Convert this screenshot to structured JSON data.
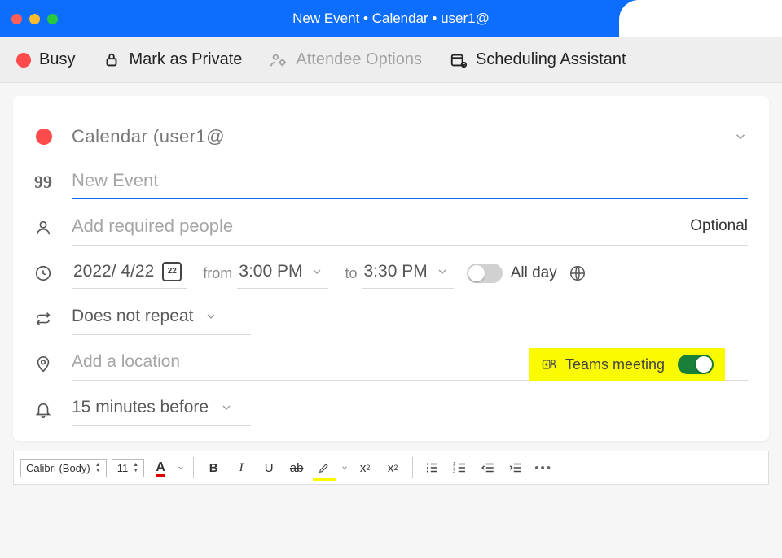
{
  "window": {
    "title": "New Event • Calendar • user1@"
  },
  "toolbar": {
    "busy_label": "Busy",
    "private_label": "Mark as Private",
    "attendee_label": "Attendee Options",
    "scheduling_label": "Scheduling Assistant"
  },
  "event": {
    "calendar_label": "Calendar (user1@",
    "title_placeholder": "New Event",
    "title_value": "",
    "people_placeholder": "Add required people",
    "optional_label": "Optional",
    "date": "2022/ 4/22",
    "date_mini": "22",
    "from_label": "from",
    "start_time": "3:00 PM",
    "to_label": "to",
    "end_time": "3:30 PM",
    "all_day_label": "All day",
    "all_day_on": false,
    "repeat_label": "Does not repeat",
    "location_placeholder": "Add a location",
    "teams_label": "Teams meeting",
    "teams_on": true,
    "reminder_label": "15 minutes before"
  },
  "format": {
    "font": "Calibri (Body)",
    "size": "11"
  }
}
